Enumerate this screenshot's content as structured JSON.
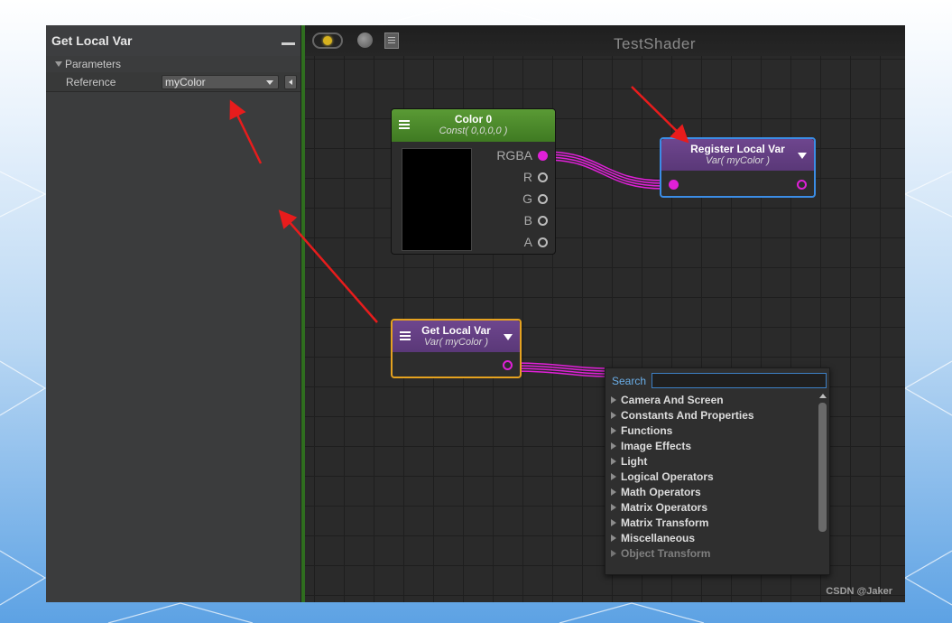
{
  "panel": {
    "title": "Get Local Var",
    "section": "Parameters",
    "reference_label": "Reference",
    "reference_value": "myColor"
  },
  "canvas": {
    "title": "TestShader",
    "watermark": "CSDN @Jaker"
  },
  "nodes": {
    "color": {
      "title": "Color 0",
      "subtitle": "Const( 0,0,0,0 )",
      "ports": [
        "RGBA",
        "R",
        "G",
        "B",
        "A"
      ]
    },
    "register": {
      "title": "Register Local Var",
      "subtitle": "Var( myColor )"
    },
    "get": {
      "title": "Get Local Var",
      "subtitle": "Var( myColor )"
    }
  },
  "search": {
    "label": "Search",
    "value": "",
    "categories": [
      "Camera And Screen",
      "Constants And Properties",
      "Functions",
      "Image Effects",
      "Light",
      "Logical Operators",
      "Math Operators",
      "Matrix Operators",
      "Matrix Transform",
      "Miscellaneous",
      "Object Transform"
    ]
  },
  "colors": {
    "accent_blue": "#3b8de6",
    "accent_orange": "#e5a21f",
    "wire_pink": "#e020d8",
    "node_green": "#4f8c2c",
    "node_purple": "#63407f",
    "arrow_red": "#e81c1c"
  }
}
